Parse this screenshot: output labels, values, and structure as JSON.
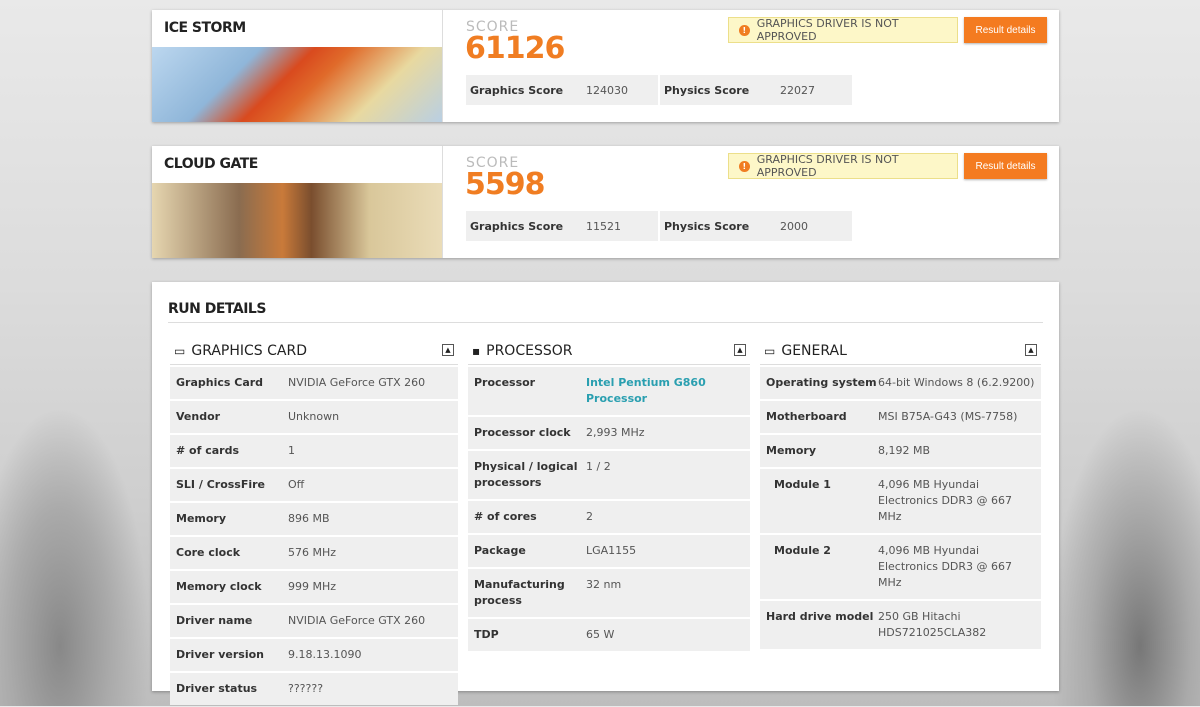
{
  "tests": [
    {
      "name": "ICE STORM",
      "score_label": "SCORE",
      "score": "61126",
      "warning": "GRAPHICS DRIVER IS NOT APPROVED",
      "button": "Result details",
      "graphics_label": "Graphics Score",
      "graphics": "124030",
      "physics_label": "Physics Score",
      "physics": "22027"
    },
    {
      "name": "CLOUD GATE",
      "score_label": "SCORE",
      "score": "5598",
      "warning": "GRAPHICS DRIVER IS NOT APPROVED",
      "button": "Result details",
      "graphics_label": "Graphics Score",
      "graphics": "11521",
      "physics_label": "Physics Score",
      "physics": "2000"
    }
  ],
  "run": {
    "title": "RUN DETAILS",
    "graphics": {
      "title": "GRAPHICS CARD",
      "rows": [
        [
          "Graphics Card",
          "NVIDIA GeForce GTX 260"
        ],
        [
          "Vendor",
          "Unknown"
        ],
        [
          "# of cards",
          "1"
        ],
        [
          "SLI / CrossFire",
          "Off"
        ],
        [
          "Memory",
          "896 MB"
        ],
        [
          "Core clock",
          "576 MHz"
        ],
        [
          "Memory clock",
          "999 MHz"
        ],
        [
          "Driver name",
          "NVIDIA GeForce GTX 260"
        ],
        [
          "Driver version",
          "9.18.13.1090"
        ],
        [
          "Driver status",
          "??????"
        ]
      ]
    },
    "processor": {
      "title": "PROCESSOR",
      "rows": [
        [
          "Processor",
          "Intel Pentium G860 Processor"
        ],
        [
          "Processor clock",
          "2,993 MHz"
        ],
        [
          "Physical / logical processors",
          "1 / 2"
        ],
        [
          "# of cores",
          "2"
        ],
        [
          "Package",
          "LGA1155"
        ],
        [
          "Manufacturing process",
          "32 nm"
        ],
        [
          "TDP",
          "65 W"
        ]
      ]
    },
    "general": {
      "title": "GENERAL",
      "rows": [
        [
          "Operating system",
          "64-bit Windows 8 (6.2.9200)"
        ],
        [
          "Motherboard",
          "MSI B75A-G43 (MS-7758)"
        ],
        [
          "Memory",
          "8,192 MB"
        ],
        [
          "Module 1",
          "4,096 MB Hyundai Electronics DDR3 @ 667 MHz"
        ],
        [
          "Module 2",
          "4,096 MB Hyundai Electronics DDR3 @ 667 MHz"
        ],
        [
          "Hard drive model",
          "250 GB Hitachi HDS721025CLA382"
        ]
      ]
    }
  }
}
